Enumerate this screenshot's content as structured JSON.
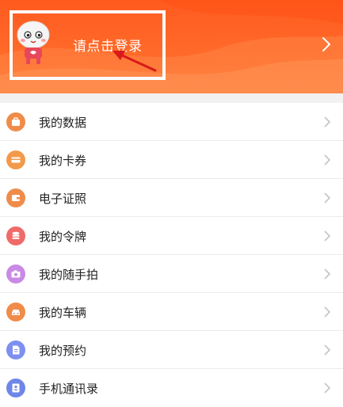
{
  "header": {
    "login_text": "请点击登录",
    "background_color": "#ff6a2a",
    "highlight_box_color": "#ffffff",
    "annotation_arrow_color": "#d91a1a"
  },
  "menu": {
    "items": [
      {
        "label": "我的数据",
        "icon": "briefcase-icon",
        "icon_color": "#f08c4a"
      },
      {
        "label": "我的卡券",
        "icon": "card-icon",
        "icon_color": "#f29a4b"
      },
      {
        "label": "电子证照",
        "icon": "wallet-icon",
        "icon_color": "#f08c4a"
      },
      {
        "label": "我的令牌",
        "icon": "database-icon",
        "icon_color": "#f06a6a"
      },
      {
        "label": "我的随手拍",
        "icon": "camera-icon",
        "icon_color": "#c98ae6"
      },
      {
        "label": "我的车辆",
        "icon": "car-icon",
        "icon_color": "#f08c4a"
      },
      {
        "label": "我的预约",
        "icon": "document-icon",
        "icon_color": "#7d8ff0"
      },
      {
        "label": "手机通讯录",
        "icon": "contacts-icon",
        "icon_color": "#6f86e8"
      }
    ]
  }
}
